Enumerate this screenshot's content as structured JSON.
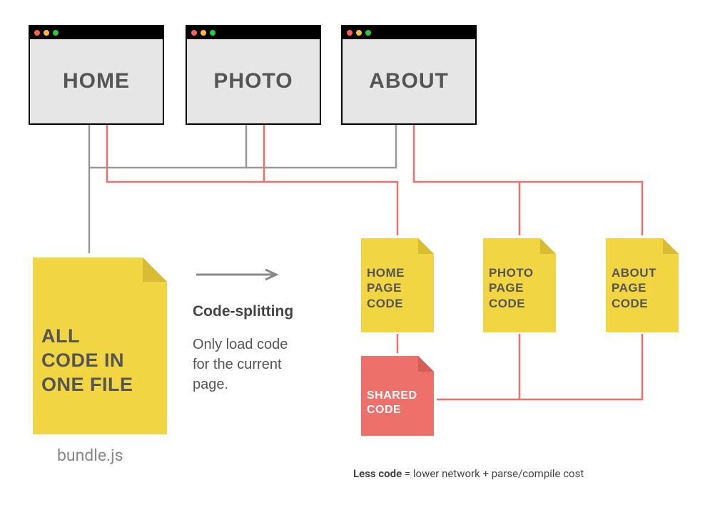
{
  "browsers": {
    "home": "HOME",
    "photo": "PHOTO",
    "about": "ABOUT"
  },
  "bundle": {
    "label": "ALL\nCODE IN\nONE FILE",
    "caption": "bundle.js"
  },
  "middle": {
    "heading": "Code-splitting",
    "sub": "Only load code\nfor the current\npage."
  },
  "chunks": {
    "home": "HOME\nPAGE\nCODE",
    "photo": "PHOTO\nPAGE\nCODE",
    "about": "ABOUT\nPAGE\nCODE",
    "shared": "SHARED\nCODE"
  },
  "footer": {
    "bold": "Less code",
    "rest": " = lower network + parse/compile cost"
  },
  "colors": {
    "yellow": "#f2d543",
    "yellow_dark": "#d9bc34",
    "salmon": "#ed706b",
    "salmon_dark": "#d55e59",
    "grey": "#888",
    "grey_light": "#e6e6e6"
  }
}
